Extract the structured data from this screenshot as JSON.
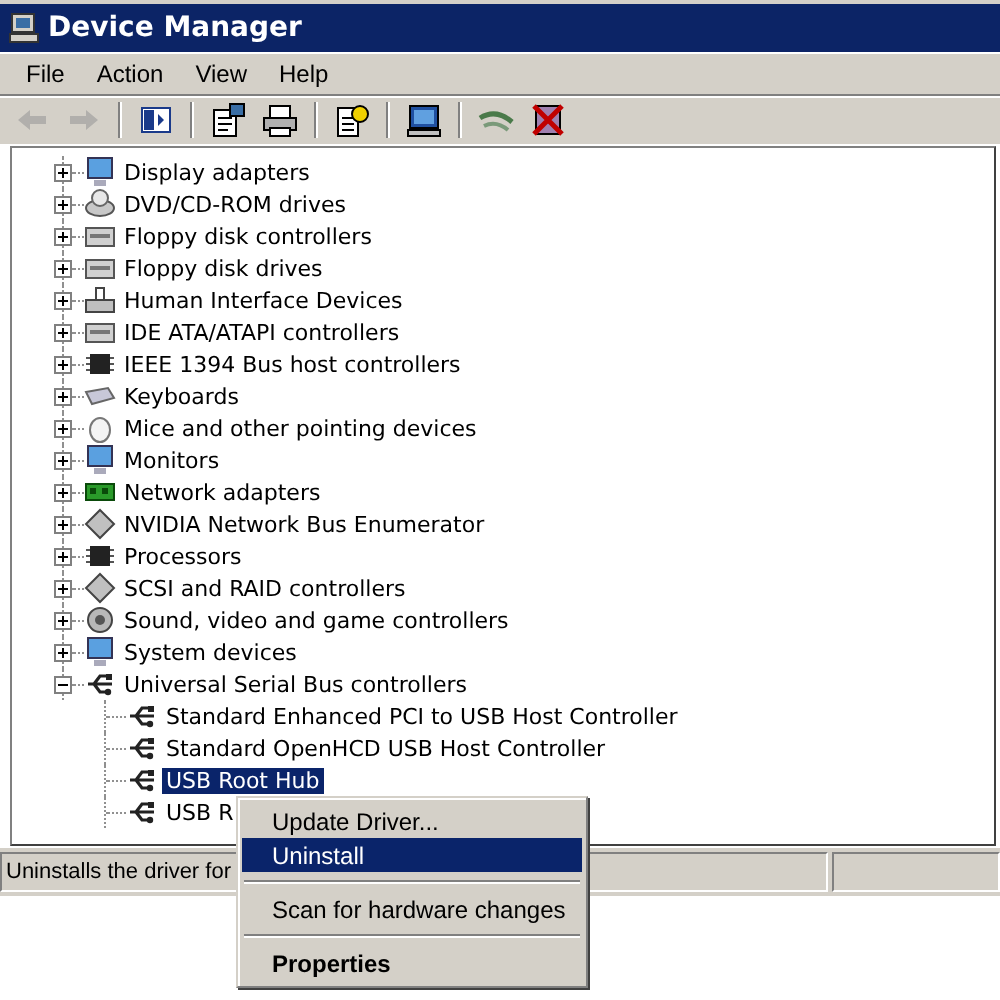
{
  "window": {
    "title": "Device Manager"
  },
  "menu": [
    "File",
    "Action",
    "View",
    "Help"
  ],
  "toolbar": [
    {
      "kind": "back",
      "disabled": true
    },
    {
      "kind": "forward",
      "disabled": true
    },
    {
      "kind": "sep"
    },
    {
      "kind": "panel",
      "disabled": false
    },
    {
      "kind": "sep"
    },
    {
      "kind": "properties",
      "disabled": false
    },
    {
      "kind": "print",
      "disabled": false
    },
    {
      "kind": "sep"
    },
    {
      "kind": "help",
      "disabled": false
    },
    {
      "kind": "sep"
    },
    {
      "kind": "scan",
      "disabled": false
    },
    {
      "kind": "sep"
    },
    {
      "kind": "network",
      "disabled": false
    },
    {
      "kind": "remove",
      "disabled": false
    }
  ],
  "tree": {
    "items": [
      {
        "label": "Display adapters",
        "expanded": false
      },
      {
        "label": "DVD/CD-ROM drives",
        "expanded": false
      },
      {
        "label": "Floppy disk controllers",
        "expanded": false
      },
      {
        "label": "Floppy disk drives",
        "expanded": false
      },
      {
        "label": "Human Interface Devices",
        "expanded": false
      },
      {
        "label": "IDE ATA/ATAPI controllers",
        "expanded": false
      },
      {
        "label": "IEEE 1394 Bus host controllers",
        "expanded": false
      },
      {
        "label": "Keyboards",
        "expanded": false
      },
      {
        "label": "Mice and other pointing devices",
        "expanded": false
      },
      {
        "label": "Monitors",
        "expanded": false
      },
      {
        "label": "Network adapters",
        "expanded": false
      },
      {
        "label": "NVIDIA Network Bus Enumerator",
        "expanded": false
      },
      {
        "label": "Processors",
        "expanded": false
      },
      {
        "label": "SCSI and RAID controllers",
        "expanded": false
      },
      {
        "label": "Sound, video and game controllers",
        "expanded": false
      },
      {
        "label": "System devices",
        "expanded": false
      },
      {
        "label": "Universal Serial Bus controllers",
        "expanded": true,
        "children": [
          {
            "label": "Standard Enhanced PCI to USB Host Controller",
            "selected": false
          },
          {
            "label": "Standard OpenHCD USB Host Controller",
            "selected": false
          },
          {
            "label": "USB Root Hub",
            "selected": true
          },
          {
            "label": "USB R",
            "selected": false
          }
        ]
      }
    ]
  },
  "context_menu": {
    "items": [
      {
        "kind": "item",
        "label": "Update Driver...",
        "selected": false,
        "default": false
      },
      {
        "kind": "item",
        "label": "Uninstall",
        "selected": true,
        "default": false
      },
      {
        "kind": "separator"
      },
      {
        "kind": "item",
        "label": "Scan for hardware changes",
        "selected": false,
        "default": false
      },
      {
        "kind": "separator"
      },
      {
        "kind": "item",
        "label": "Properties",
        "selected": false,
        "default": true
      }
    ]
  },
  "status_bar": {
    "text": "Uninstalls the driver for"
  }
}
